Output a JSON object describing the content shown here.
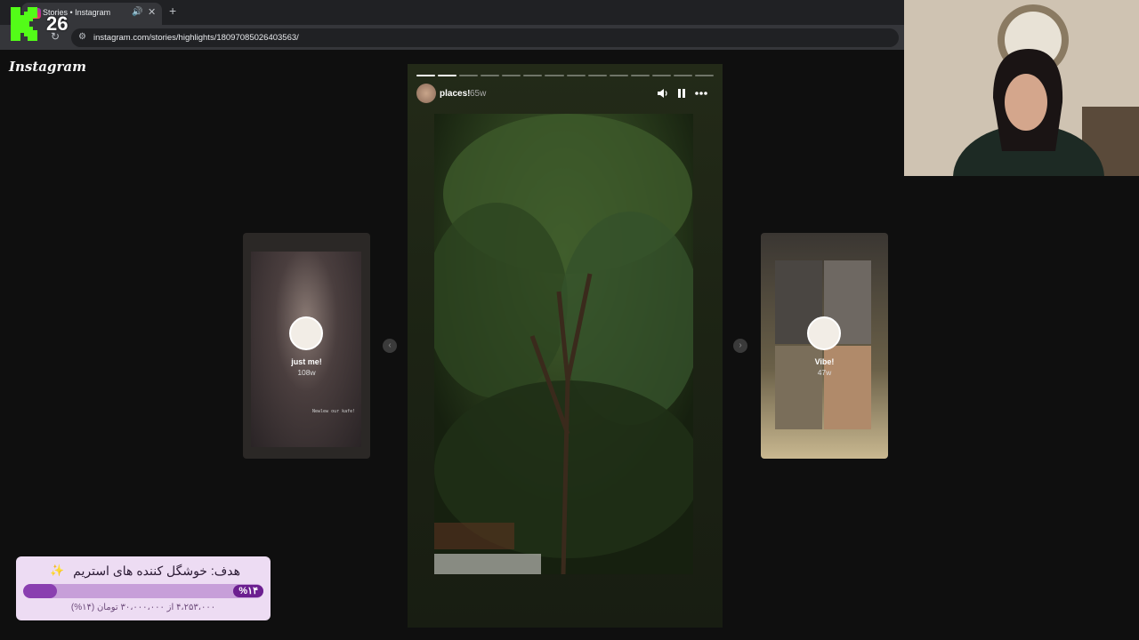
{
  "browser": {
    "tab_title": "Stories • Instagram",
    "url": "instagram.com/stories/highlights/18097085026403563/"
  },
  "overlay": {
    "badge_number": "26"
  },
  "instagram": {
    "logo": "Instagram"
  },
  "story": {
    "username": "places!",
    "time": "65w",
    "progress": {
      "segments": 14,
      "completed": 2
    }
  },
  "prev_card": {
    "title": "just me!",
    "time": "108w",
    "caption": "Newlew our kafe!"
  },
  "next_card": {
    "title": "Vibe!",
    "time": "47w"
  },
  "goal": {
    "title": "هدف: خوشگل کننده های استریم",
    "emoji": "✨",
    "percent_label": "%۱۴",
    "percent": 14,
    "subtitle": "۴،۲۵۳،۰۰۰ از ۳۰،۰۰۰،۰۰۰ تومان (۱۴%)"
  },
  "colors": {
    "page_bg": "#0f0f0f",
    "goal_fill": "#8a3fb0",
    "goal_badge": "#6c1f90",
    "kick_green": "#53fc18"
  }
}
